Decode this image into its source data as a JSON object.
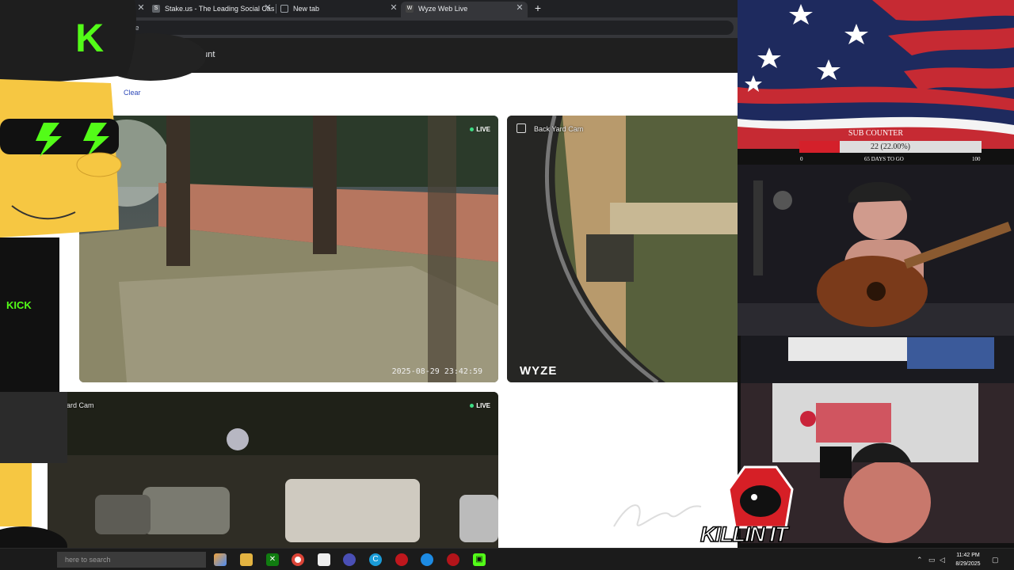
{
  "browser": {
    "tabs": [
      {
        "title": "Stake.us - The Leading Social Cas",
        "favicon": "S",
        "active": false
      },
      {
        "title": "New tab",
        "favicon": "",
        "active": false
      },
      {
        "title": "Wyze Web Live",
        "favicon": "W",
        "active": true
      }
    ],
    "address_fragment": "live",
    "account_fragment": "ount"
  },
  "page": {
    "clear_link": "Clear",
    "cameras": [
      {
        "name": "",
        "live": "LIVE",
        "timestamp": "2025-08-29  23:42:59",
        "brand": ""
      },
      {
        "name": "Back Yard Cam",
        "live": "",
        "timestamp": "",
        "brand": "WYZE"
      },
      {
        "name": "ard Cam",
        "live": "LIVE",
        "timestamp": "",
        "brand": ""
      }
    ]
  },
  "overlay": {
    "sub_counter": {
      "title": "SUB COUNTER",
      "progress_text": "22 (22.00%)",
      "progress": 0.22,
      "min": "0",
      "max": "100",
      "days": "65 DAYS TO GO"
    },
    "character_letter": "K",
    "character_shirt": "KICK",
    "banner_text": "KILLIN IT"
  },
  "taskbar": {
    "search_placeholder": "here to search",
    "time": "11:42 PM",
    "date": "8/29/2025"
  },
  "colors": {
    "live_dot": "#3ddc84",
    "sub_fill": "#d4202a",
    "kick_green": "#53fc18"
  }
}
